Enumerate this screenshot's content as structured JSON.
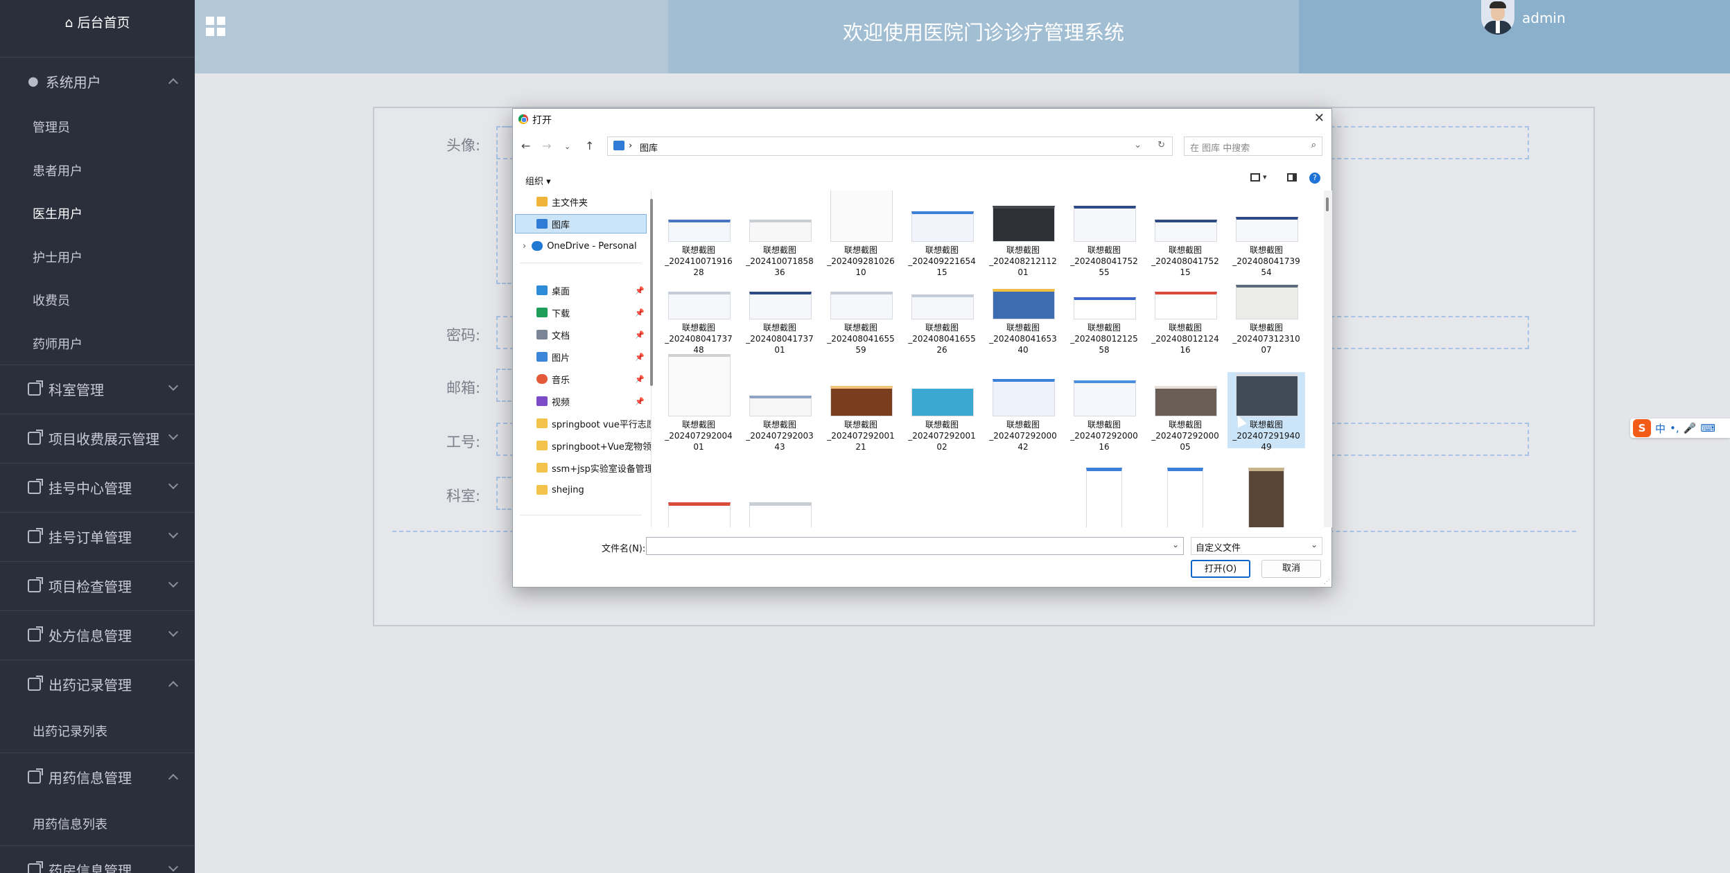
{
  "header": {
    "title": "欢迎使用医院门诊诊疗管理系统",
    "user": "admin"
  },
  "sidebar": {
    "home": "后台首页",
    "groups": [
      {
        "label": "系统用户",
        "expanded": true,
        "items": [
          "管理员",
          "患者用户",
          "医生用户",
          "护士用户",
          "收费员",
          "药师用户"
        ]
      },
      {
        "label": "科室管理",
        "expanded": false
      },
      {
        "label": "项目收费展示管理",
        "expanded": false
      },
      {
        "label": "挂号中心管理",
        "expanded": false
      },
      {
        "label": "挂号订单管理",
        "expanded": false
      },
      {
        "label": "项目检查管理",
        "expanded": false
      },
      {
        "label": "处方信息管理",
        "expanded": false
      },
      {
        "label": "出药记录管理",
        "expanded": true,
        "items": [
          "出药记录列表"
        ]
      },
      {
        "label": "用药信息管理",
        "expanded": true,
        "items": [
          "用药信息列表"
        ]
      },
      {
        "label": "药房信息管理",
        "expanded": false
      }
    ],
    "active_item": "医生用户"
  },
  "form": {
    "labels": {
      "avatar": "头像:",
      "password": "密码:",
      "email": "邮箱:",
      "job_no": "工号:",
      "dept": "科室:"
    }
  },
  "dialog": {
    "title": "打开",
    "breadcrumb": "图库",
    "search_placeholder": "在 图库 中搜索",
    "organize": "组织",
    "tree": [
      {
        "label": "主文件夹",
        "icon": "home-icon"
      },
      {
        "label": "图库",
        "icon": "gallery-icon",
        "selected": true
      },
      {
        "label": "OneDrive - Personal",
        "icon": "cloud-icon"
      },
      {
        "label": "桌面",
        "icon": "desktop-icon",
        "pinned": true
      },
      {
        "label": "下载",
        "icon": "download-icon",
        "pinned": true
      },
      {
        "label": "文档",
        "icon": "document-icon",
        "pinned": true
      },
      {
        "label": "图片",
        "icon": "pictures-icon",
        "pinned": true
      },
      {
        "label": "音乐",
        "icon": "music-icon",
        "pinned": true
      },
      {
        "label": "视频",
        "icon": "video-icon",
        "pinned": true
      },
      {
        "label": "springboot vue平行志愿",
        "icon": "folder-icon"
      },
      {
        "label": "springboot+Vue宠物领养",
        "icon": "folder-icon"
      },
      {
        "label": "ssm+jsp实验室设备管理",
        "icon": "folder-icon"
      },
      {
        "label": "shejing",
        "icon": "folder-icon"
      }
    ],
    "files": [
      [
        "联想截图",
        "_202410071916",
        "28"
      ],
      [
        "联想截图",
        "_202410071858",
        "36"
      ],
      [
        "联想截图",
        "_202409281026",
        "10"
      ],
      [
        "联想截图",
        "_202409221654",
        "15"
      ],
      [
        "联想截图",
        "_202408212112",
        "01"
      ],
      [
        "联想截图",
        "_202408041752",
        "55"
      ],
      [
        "联想截图",
        "_202408041752",
        "15"
      ],
      [
        "联想截图",
        "_202408041739",
        "54"
      ],
      [
        "联想截图",
        "_202408041737",
        "48"
      ],
      [
        "联想截图",
        "_202408041737",
        "01"
      ],
      [
        "联想截图",
        "_202408041655",
        "59"
      ],
      [
        "联想截图",
        "_202408041655",
        "26"
      ],
      [
        "联想截图",
        "_202408041653",
        "40"
      ],
      [
        "联想截图",
        "_202408012125",
        "58"
      ],
      [
        "联想截图",
        "_202408012124",
        "16"
      ],
      [
        "联想截图",
        "_202407312310",
        "07"
      ],
      [
        "联想截图",
        "_202407292004",
        "01"
      ],
      [
        "联想截图",
        "_202407292003",
        "43"
      ],
      [
        "联想截图",
        "_202407292001",
        "21"
      ],
      [
        "联想截图",
        "_202407292001",
        "02"
      ],
      [
        "联想截图",
        "_202407292000",
        "42"
      ],
      [
        "联想截图",
        "_202407292000",
        "16"
      ],
      [
        "联想截图",
        "_202407292000",
        "05"
      ],
      [
        "联想截图",
        "_202407291940",
        "49"
      ]
    ],
    "selected_file_index": 23,
    "filename_label": "文件名(N):",
    "filename_value": "",
    "filetype": "自定义文件",
    "open_button": "打开(O)",
    "cancel_button": "取消"
  },
  "ime": {
    "logo": "S",
    "lang": "中"
  }
}
